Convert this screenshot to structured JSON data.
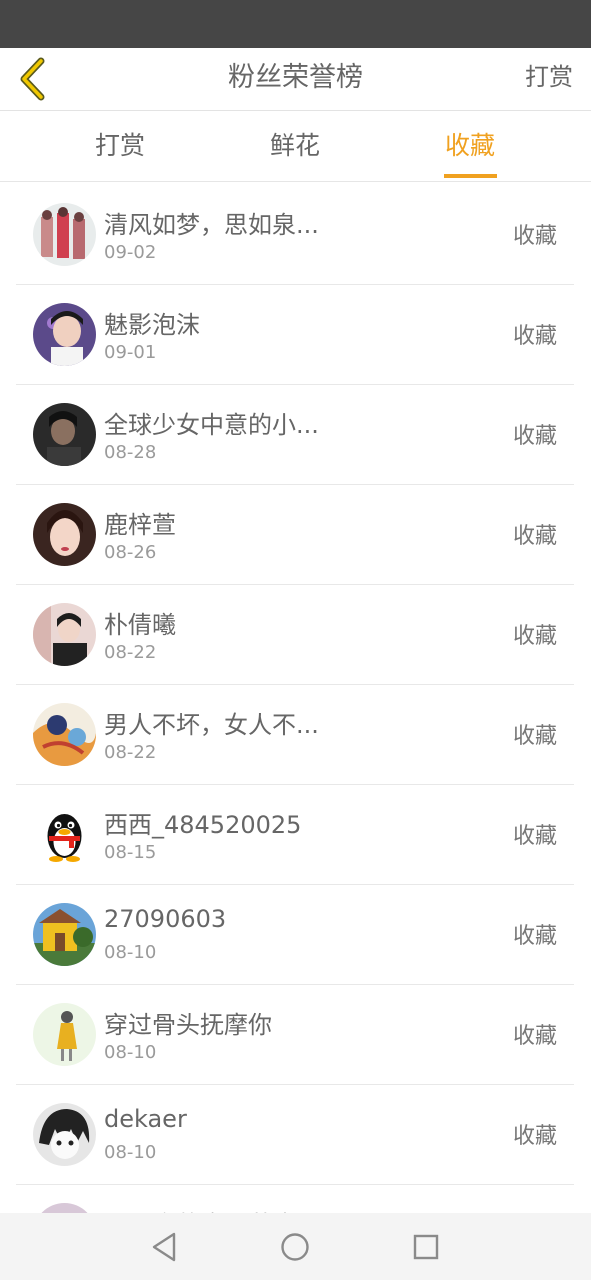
{
  "header": {
    "title": "粉丝荣誉榜",
    "action_label": "打赏",
    "back_icon": "chevron-left-icon"
  },
  "tabs": [
    {
      "label": "打赏",
      "active": false
    },
    {
      "label": "鲜花",
      "active": false
    },
    {
      "label": "收藏",
      "active": true
    }
  ],
  "colors": {
    "accent": "#f0a120",
    "text": "#666666",
    "subtext": "#9a9a9a",
    "status_bar": "#464646"
  },
  "fans": [
    {
      "name": "清风如梦，思如泉...",
      "date": "09-02",
      "action": "收藏"
    },
    {
      "name": "魅影泡沫",
      "date": "09-01",
      "action": "收藏"
    },
    {
      "name": "全球少女中意的小...",
      "date": "08-28",
      "action": "收藏"
    },
    {
      "name": "鹿梓萱",
      "date": "08-26",
      "action": "收藏"
    },
    {
      "name": "朴倩曦",
      "date": "08-22",
      "action": "收藏"
    },
    {
      "name": "男人不坏，女人不...",
      "date": "08-22",
      "action": "收藏"
    },
    {
      "name": "西西_484520025",
      "date": "08-15",
      "action": "收藏"
    },
    {
      "name": "27090603",
      "date": "08-10",
      "action": "收藏"
    },
    {
      "name": "穿过骨头抚摩你",
      "date": "08-10",
      "action": "收藏"
    },
    {
      "name": "dekaer",
      "date": "08-10",
      "action": "收藏"
    },
    {
      "name": "EXO家的宝贝莱米",
      "date": "",
      "action": ""
    }
  ],
  "navbar": {
    "back_icon": "triangle-back-icon",
    "home_icon": "circle-home-icon",
    "recent_icon": "square-recent-icon"
  }
}
